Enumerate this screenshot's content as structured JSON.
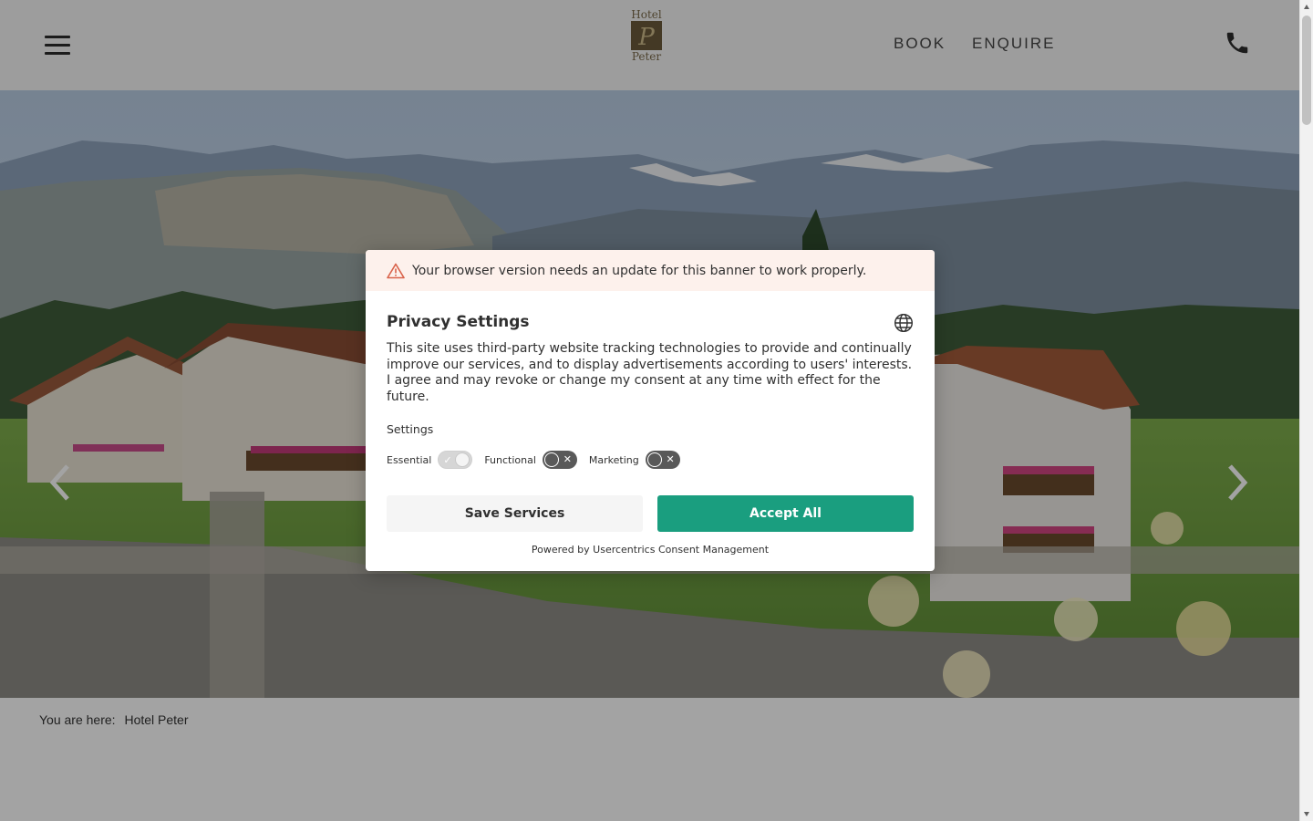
{
  "header": {
    "logo": {
      "top_text": "Hotel",
      "mark_letter": "P",
      "bottom_text": "Peter"
    },
    "nav": {
      "book": "BOOK",
      "enquire": "ENQUIRE"
    },
    "icons": {
      "menu": "hamburger-menu-icon",
      "phone": "phone-icon"
    }
  },
  "hero": {
    "prev_icon": "chevron-left-icon",
    "next_icon": "chevron-right-icon"
  },
  "breadcrumb": {
    "label": "You are here:",
    "current": "Hotel Peter"
  },
  "consent": {
    "warning": "Your browser version needs an update for this banner to work properly.",
    "title": "Privacy Settings",
    "description": "This site uses third-party website tracking technologies to provide and continually improve our services, and to display advertisements according to users' interests. I agree and may revoke or change my consent at any time with effect for the future.",
    "settings_label": "Settings",
    "toggles": [
      {
        "label": "Essential",
        "state": "on-disabled"
      },
      {
        "label": "Functional",
        "state": "off"
      },
      {
        "label": "Marketing",
        "state": "off"
      }
    ],
    "save_button": "Save Services",
    "accept_button": "Accept All",
    "powered_by": "Powered by Usercentrics Consent Management"
  },
  "colors": {
    "accent": "#1a9e7f",
    "warning_bg": "#fdf1ec",
    "warning_icon": "#d9624a"
  }
}
